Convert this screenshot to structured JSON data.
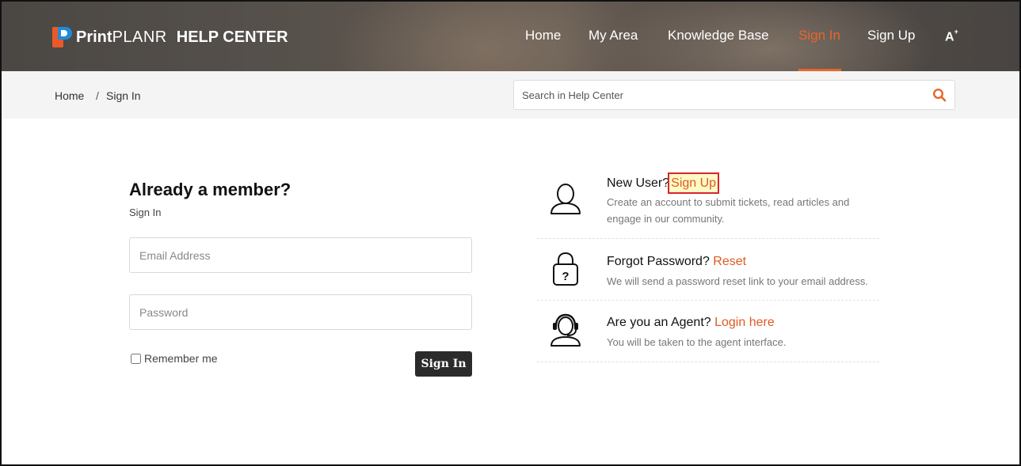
{
  "brand": {
    "name_bold": "Print",
    "name_light": "PLANR",
    "suffix": "HELP CENTER"
  },
  "nav": {
    "items": [
      {
        "label": "Home",
        "active": false
      },
      {
        "label": "My Area",
        "active": false
      },
      {
        "label": "Knowledge Base",
        "active": false
      },
      {
        "label": "Sign In",
        "active": true
      },
      {
        "label": "Sign Up",
        "active": false
      }
    ],
    "font_icon": "font-size-icon",
    "font_icon_text": "A",
    "font_icon_sup": "+"
  },
  "breadcrumb": {
    "items": [
      "Home",
      "Sign In"
    ],
    "separator": "/"
  },
  "search": {
    "placeholder": "Search in Help Center",
    "icon": "search-icon"
  },
  "signin": {
    "title": "Already a member?",
    "subtitle": "Sign In",
    "email_placeholder": "Email Address",
    "password_placeholder": "Password",
    "remember_label": "Remember me",
    "remember_checked": false,
    "button_label": "Sign In"
  },
  "options": [
    {
      "icon": "user-icon",
      "question": "New User?",
      "link": "Sign Up",
      "description": "Create an account to submit tickets, read articles and engage in our community."
    },
    {
      "icon": "padlock-question-icon",
      "question": "Forgot Password?",
      "link": "Reset",
      "description": "We will send a password reset link to your email address."
    },
    {
      "icon": "agent-headset-icon",
      "question": "Are you an Agent?",
      "link": "Login here",
      "description": "You will be taken to the agent interface."
    }
  ],
  "colors": {
    "accent": "#e7672a",
    "link": "#e05a22",
    "button_bg": "#2b2b2b",
    "highlight_border": "#d7262e",
    "highlight_bg": "#fdfac6"
  }
}
